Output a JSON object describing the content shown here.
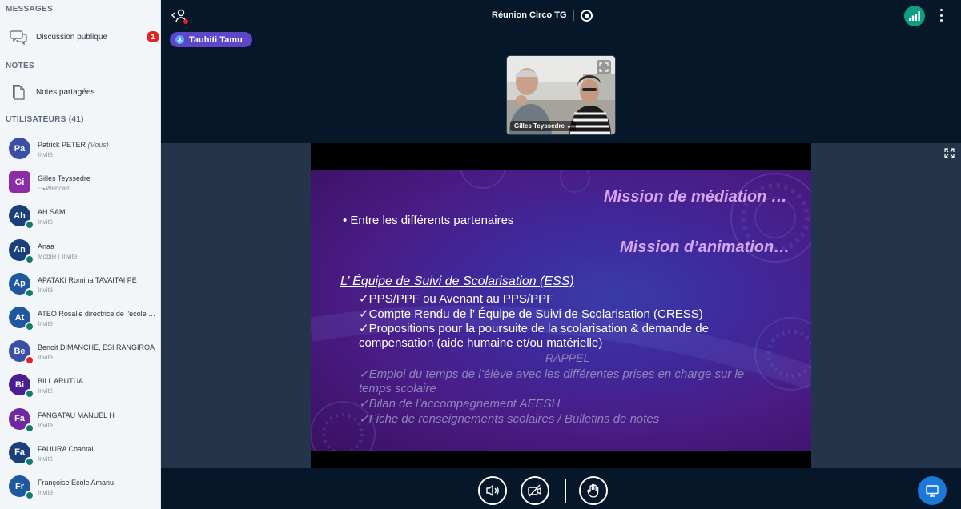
{
  "sidebar": {
    "messages_title": "MESSAGES",
    "public_chat": {
      "label": "Discussion publique",
      "badge": "1",
      "icon": "chat-bubbles-icon"
    },
    "notes_title": "NOTES",
    "shared_notes": {
      "label": "Notes partagées",
      "icon": "document-icon"
    },
    "users_title": "UTILISATEURS (41)",
    "users": [
      {
        "initials": "Pa",
        "name": "Patrick PETER",
        "suffix": "(Vous)",
        "role": "Invité",
        "color": "#3a4fa6",
        "square": false,
        "status": "none"
      },
      {
        "initials": "Gi",
        "name": "Gilles Teyssedre",
        "suffix": "",
        "role": "Webcam",
        "color": "#8c2ca7",
        "square": true,
        "status": "none"
      },
      {
        "initials": "Ah",
        "name": "AH SAM",
        "suffix": "",
        "role": "Invité",
        "color": "#1a3f7a",
        "square": false,
        "status": "listen"
      },
      {
        "initials": "An",
        "name": "Anaa",
        "suffix": "",
        "role": "Mobile | Invité",
        "color": "#1a3f7a",
        "square": false,
        "status": "listen"
      },
      {
        "initials": "Ap",
        "name": "APATAKI Romina TAVAITAI PE",
        "suffix": "",
        "role": "Invité",
        "color": "#1f58a0",
        "square": false,
        "status": "listen"
      },
      {
        "initials": "At",
        "name": "ATEO Rosalie directrice de l'école d...",
        "suffix": "",
        "role": "Invité",
        "color": "#1f58a0",
        "square": false,
        "status": "listen"
      },
      {
        "initials": "Be",
        "name": "Benoit DIMANCHE, ESI RANGIROA",
        "suffix": "",
        "role": "Invité",
        "color": "#3a4fa6",
        "square": false,
        "status": "muted"
      },
      {
        "initials": "Bi",
        "name": "BILL ARUTUA",
        "suffix": "",
        "role": "Invité",
        "color": "#4b1f8f",
        "square": false,
        "status": "listen"
      },
      {
        "initials": "Fa",
        "name": "FANGATAU MANUEL H",
        "suffix": "",
        "role": "Invité",
        "color": "#6e2aa0",
        "square": false,
        "status": "listen"
      },
      {
        "initials": "Fa",
        "name": "FAUURA Chantal",
        "suffix": "",
        "role": "Invité",
        "color": "#1a3f7a",
        "square": false,
        "status": "listen"
      },
      {
        "initials": "Fr",
        "name": "Françoise Ecole Amanu",
        "suffix": "",
        "role": "Invité",
        "color": "#1f58a0",
        "square": false,
        "status": "listen"
      }
    ]
  },
  "topbar": {
    "meeting_title": "Réunion Circo TG",
    "leave_icon": "user-leave-icon",
    "record_icon": "record-icon",
    "connection_icon": "signal-bars-icon",
    "more_icon": "kebab-menu-icon"
  },
  "talking": {
    "name": "Tauhiti Tamu",
    "icon": "microphone-icon"
  },
  "webcam": {
    "name": "Gilles Teyssedre ⌄"
  },
  "slide": {
    "heading1": "Mission de médiation …",
    "bullet1": "•  Entre les différents partenaires",
    "heading2": "Mission d’animation…",
    "ess_title": "L’ Équipe de Suivi de Scolarisation (ESS)",
    "items": [
      "✓PPS/PPF ou Avenant au PPS/PPF",
      "✓Compte Rendu de l’ Équipe de Suivi de Scolarisation (CRESS)",
      "✓Propositions pour la poursuite de la scolarisation & demande de",
      "compensation (aide humaine et/ou matérielle)"
    ],
    "rappel": "RAPPEL",
    "faded_items": [
      "✓Emploi du temps de l’élève avec les différentes prises en charge sur le",
      "temps scolaire",
      "✓Bilan de l’accompagnement AEESH",
      "✓Fiche de renseignements scolaires  /  Bulletins de notes"
    ]
  },
  "controls": {
    "audio_icon": "speaker-icon",
    "video_icon": "camera-off-icon",
    "raise_hand_icon": "hand-icon",
    "screen_share_icon": "monitor-icon"
  },
  "colors": {
    "sidebar_bg": "#f3f6f9",
    "main_bg": "#06172a",
    "accent": "#1d79d9",
    "talker": "#5b47c7",
    "badge": "#df2721"
  }
}
